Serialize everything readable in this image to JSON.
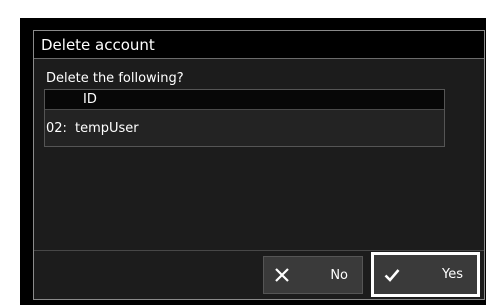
{
  "dialog": {
    "title": "Delete account",
    "prompt": "Delete the following?",
    "column_id": "ID",
    "rows": [
      {
        "num": "02:",
        "name": "tempUser"
      }
    ]
  },
  "buttons": {
    "no_label": "No",
    "no_icon": "close-icon",
    "yes_label": "Yes",
    "yes_icon": "checkmark-icon"
  }
}
